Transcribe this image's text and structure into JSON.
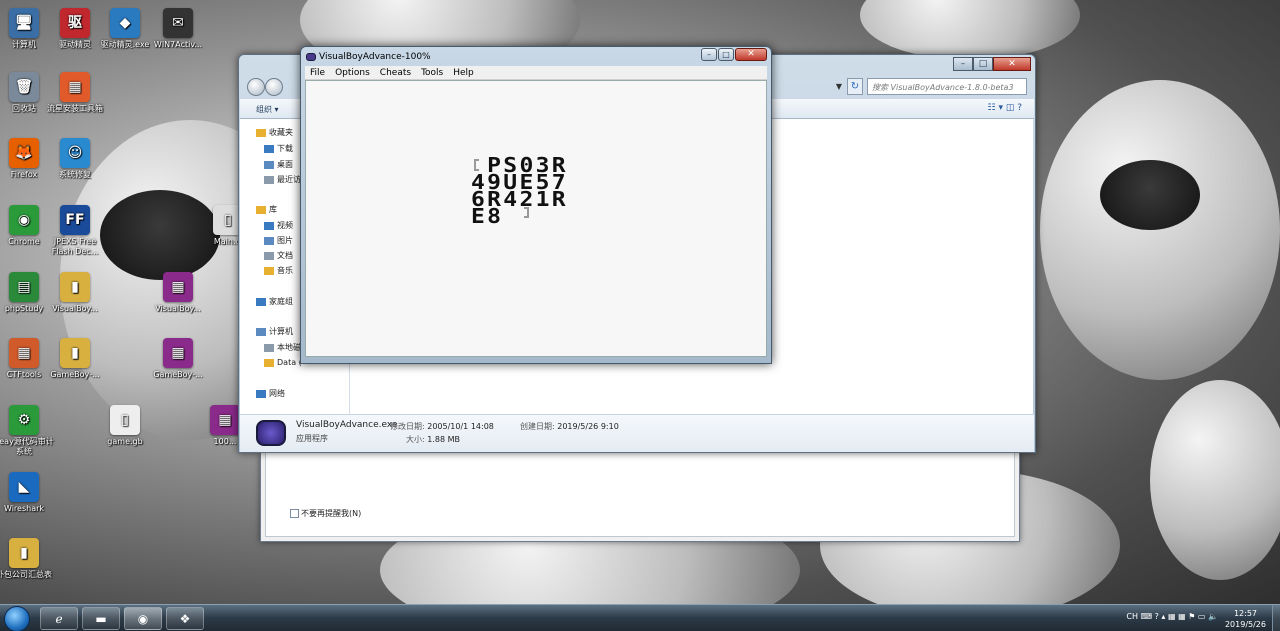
{
  "desktop": {
    "icons": [
      {
        "label": "计算机",
        "glyph": "🖥",
        "color": "#3a6ea5"
      },
      {
        "label": "驱动精灵",
        "glyph": "驱",
        "color": "#c0282e"
      },
      {
        "label": "驱动精灵.exe",
        "glyph": "◆",
        "color": "#2a7ac0"
      },
      {
        "label": "WIN7Activ...",
        "glyph": "✉",
        "color": "#333333"
      },
      {
        "label": "回收站",
        "glyph": "🗑",
        "color": "#7a8a9a"
      },
      {
        "label": "流星安装工具箱",
        "glyph": "▦",
        "color": "#e05a2a"
      },
      {
        "label": "Firefox",
        "glyph": "🦊",
        "color": "#e66000"
      },
      {
        "label": "系统修复",
        "glyph": "☺",
        "color": "#2a8ad0"
      },
      {
        "label": "Chrome",
        "glyph": "◉",
        "color": "#2a9a3a"
      },
      {
        "label": "JPEXS Free Flash Dec...",
        "glyph": "FF",
        "color": "#1a4a9a"
      },
      {
        "label": "Main.cl",
        "glyph": "▯",
        "color": "#dddddd"
      },
      {
        "label": "phpStudy",
        "glyph": "▤",
        "color": "#2a8a3a"
      },
      {
        "label": "VisualBoy...",
        "glyph": "▮",
        "color": "#d8b040"
      },
      {
        "label": "VisualBoy...",
        "glyph": "▦",
        "color": "#8a2a8a"
      },
      {
        "label": "CTFtools",
        "glyph": "▦",
        "color": "#d05a2a"
      },
      {
        "label": "GameBoy-...",
        "glyph": "▮",
        "color": "#d8b040"
      },
      {
        "label": "GameBoy-...",
        "glyph": "▦",
        "color": "#8a2a8a"
      },
      {
        "label": "Seay源代码审计系统",
        "glyph": "⚙",
        "color": "#2a9a3a"
      },
      {
        "label": "game.gb",
        "glyph": "▯",
        "color": "#eeeeee"
      },
      {
        "label": "100...",
        "glyph": "▦",
        "color": "#8a2a8a"
      },
      {
        "label": "Wireshark",
        "glyph": "◣",
        "color": "#1a6ac0"
      },
      {
        "label": "外包公司汇总表",
        "glyph": "▮",
        "color": "#d8b040"
      }
    ]
  },
  "explorer": {
    "search_placeholder": "搜索 VisualBoyAdvance-1.8.0-beta3",
    "organize": "组织 ▾",
    "view_icon": "☷ ▾  ◫  ?",
    "nav": [
      {
        "label": "收藏夹",
        "icon": "star-icon"
      },
      {
        "label": "下载",
        "icon": "folder-icon"
      },
      {
        "label": "桌面",
        "icon": "desktop-icon"
      },
      {
        "label": "最近访",
        "icon": "recent-icon"
      },
      {
        "label": "库",
        "icon": "library-icon"
      },
      {
        "label": "视频",
        "icon": "video-icon"
      },
      {
        "label": "图片",
        "icon": "picture-icon"
      },
      {
        "label": "文档",
        "icon": "document-icon"
      },
      {
        "label": "音乐",
        "icon": "music-icon"
      },
      {
        "label": "家庭组",
        "icon": "homegroup-icon"
      },
      {
        "label": "计算机",
        "icon": "computer-icon"
      },
      {
        "label": "本地磁",
        "icon": "disk-icon"
      },
      {
        "label": "Data (",
        "icon": "disk-icon"
      },
      {
        "label": "网络",
        "icon": "network-icon"
      }
    ],
    "details": {
      "filename": "VisualBoyAdvance.exe",
      "type": "应用程序",
      "modified_label": "修改日期:",
      "modified_value": "2005/10/1 14:08",
      "size_label": "大小:",
      "size_value": "1.88 MB",
      "created_label": "创建日期:",
      "created_value": "2019/5/26 9:10"
    }
  },
  "dialog": {
    "checkbox_label": "不要再提醒我(N)"
  },
  "vba": {
    "title": "VisualBoyAdvance-100%",
    "menu": [
      "File",
      "Options",
      "Cheats",
      "Tools",
      "Help"
    ],
    "screen_lines": [
      "PS03R",
      "49UE57",
      "6R421R",
      "E8"
    ]
  },
  "taskbar": {
    "lang": "CH",
    "time": "12:57",
    "date": "2019/5/26"
  }
}
